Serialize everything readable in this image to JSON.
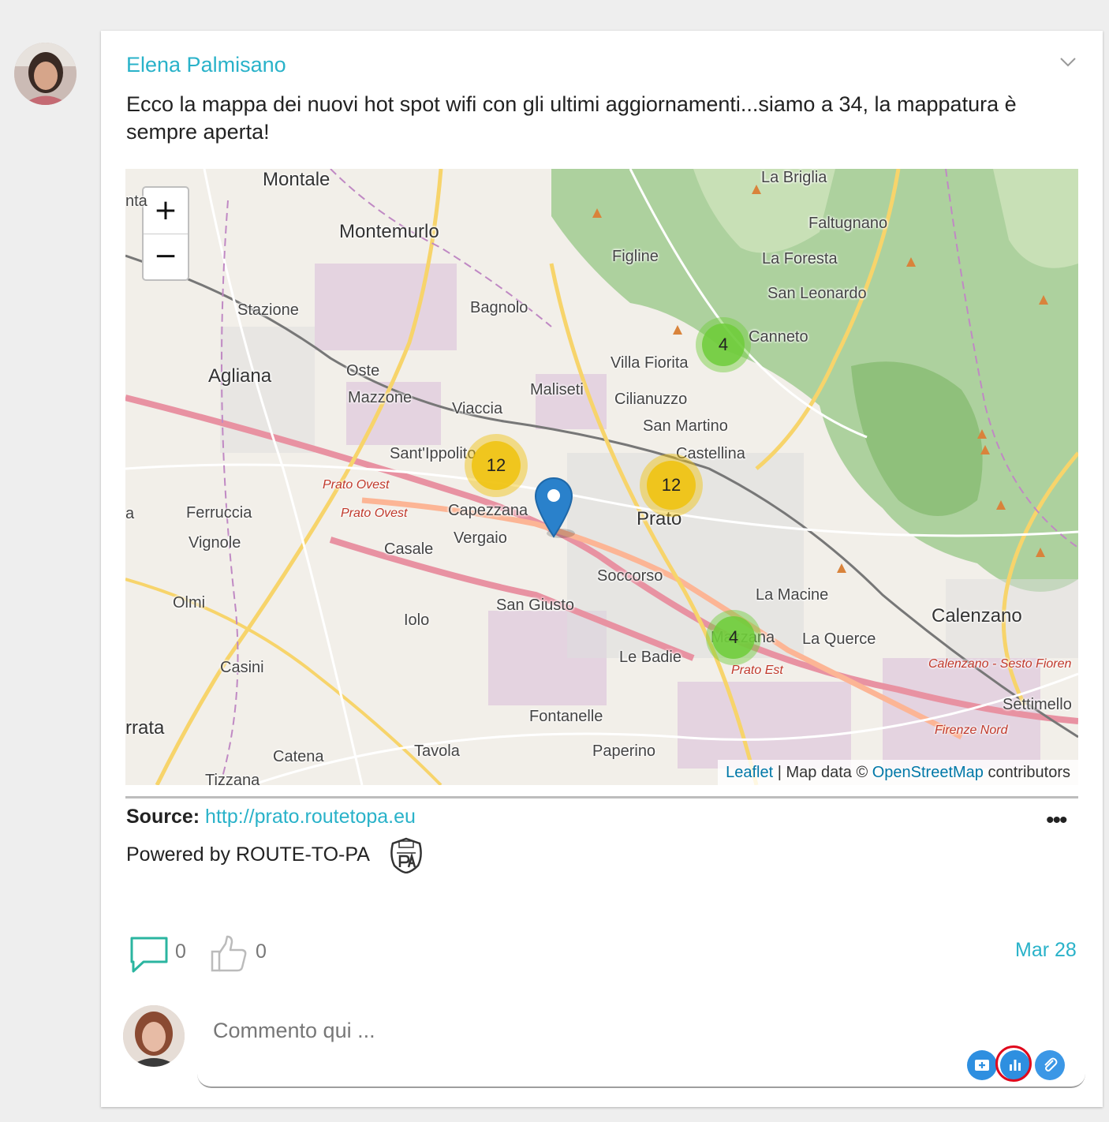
{
  "post": {
    "author": "Elena Palmisano",
    "text": "Ecco la mappa dei nuovi hot spot wifi con gli ultimi aggiornamenti...siamo a 34, la mappatura è sempre aperta!",
    "source_label": "Source:",
    "source_url": "http://prato.routetopa.eu",
    "powered_by": "Powered by ROUTE-TO-PA",
    "more_label": "•••",
    "comment_count": "0",
    "like_count": "0",
    "date": "Mar 28"
  },
  "map": {
    "zoom_in": "+",
    "zoom_out": "−",
    "places": {
      "montale": "Montale",
      "montemurlo": "Montemurlo",
      "nta": "nta",
      "la_briglia": "La Briglia",
      "faltugnano": "Faltugnano",
      "figline": "Figline",
      "la_foresta": "La Foresta",
      "san_leonardo": "San Leonardo",
      "stazione": "Stazione",
      "bagnolo": "Bagnolo",
      "canneto": "Canneto",
      "villa_fiorita": "Villa Fiorita",
      "agliana": "Agliana",
      "oste": "Oste",
      "maliseti": "Maliseti",
      "cilianuzzo": "Cilianuzzo",
      "mazzone": "Mazzone",
      "viaccia": "Viaccia",
      "san_martino": "San Martino",
      "sant_ippolito": "Sant'Ippolito",
      "castellina": "Castellina",
      "prato_ovest_1": "Prato Ovest",
      "prato_ovest_2": "Prato Ovest",
      "capezzana": "Capezzana",
      "prato": "Prato",
      "a": "a",
      "ferruccia": "Ferruccia",
      "vignole": "Vignole",
      "vergaio": "Vergaio",
      "casale": "Casale",
      "soccorso": "Soccorso",
      "la_macine": "La Macine",
      "olmi": "Olmi",
      "san_giusto": "San Giusto",
      "iolo": "Iolo",
      "calenzano": "Calenzano",
      "mazzana": "Mazzana",
      "la_querce": "La Querce",
      "le_badie": "Le Badie",
      "casini": "Casini",
      "prato_est": "Prato Est",
      "calenzano_sesto": "Calenzano - Sesto Fioren",
      "settimello": "Settimello",
      "rrata": "rrata",
      "fontanelle": "Fontanelle",
      "firenze_nord": "Firenze Nord",
      "tavola": "Tavola",
      "paperino": "Paperino",
      "catena": "Catena",
      "tizzana": "Tizzana"
    },
    "clusters": {
      "c1": "4",
      "c2": "12",
      "c3": "12",
      "c4": "4"
    },
    "attribution": {
      "leaflet": "Leaflet",
      "sep": " | Map data © ",
      "osm": "OpenStreetMap",
      "contributors": " contributors"
    }
  },
  "comment": {
    "placeholder": "Commento qui ..."
  },
  "colors": {
    "accent": "#29b2c9",
    "tool_blue": "#2e8fe0",
    "highlight_ring": "#e0081c"
  }
}
